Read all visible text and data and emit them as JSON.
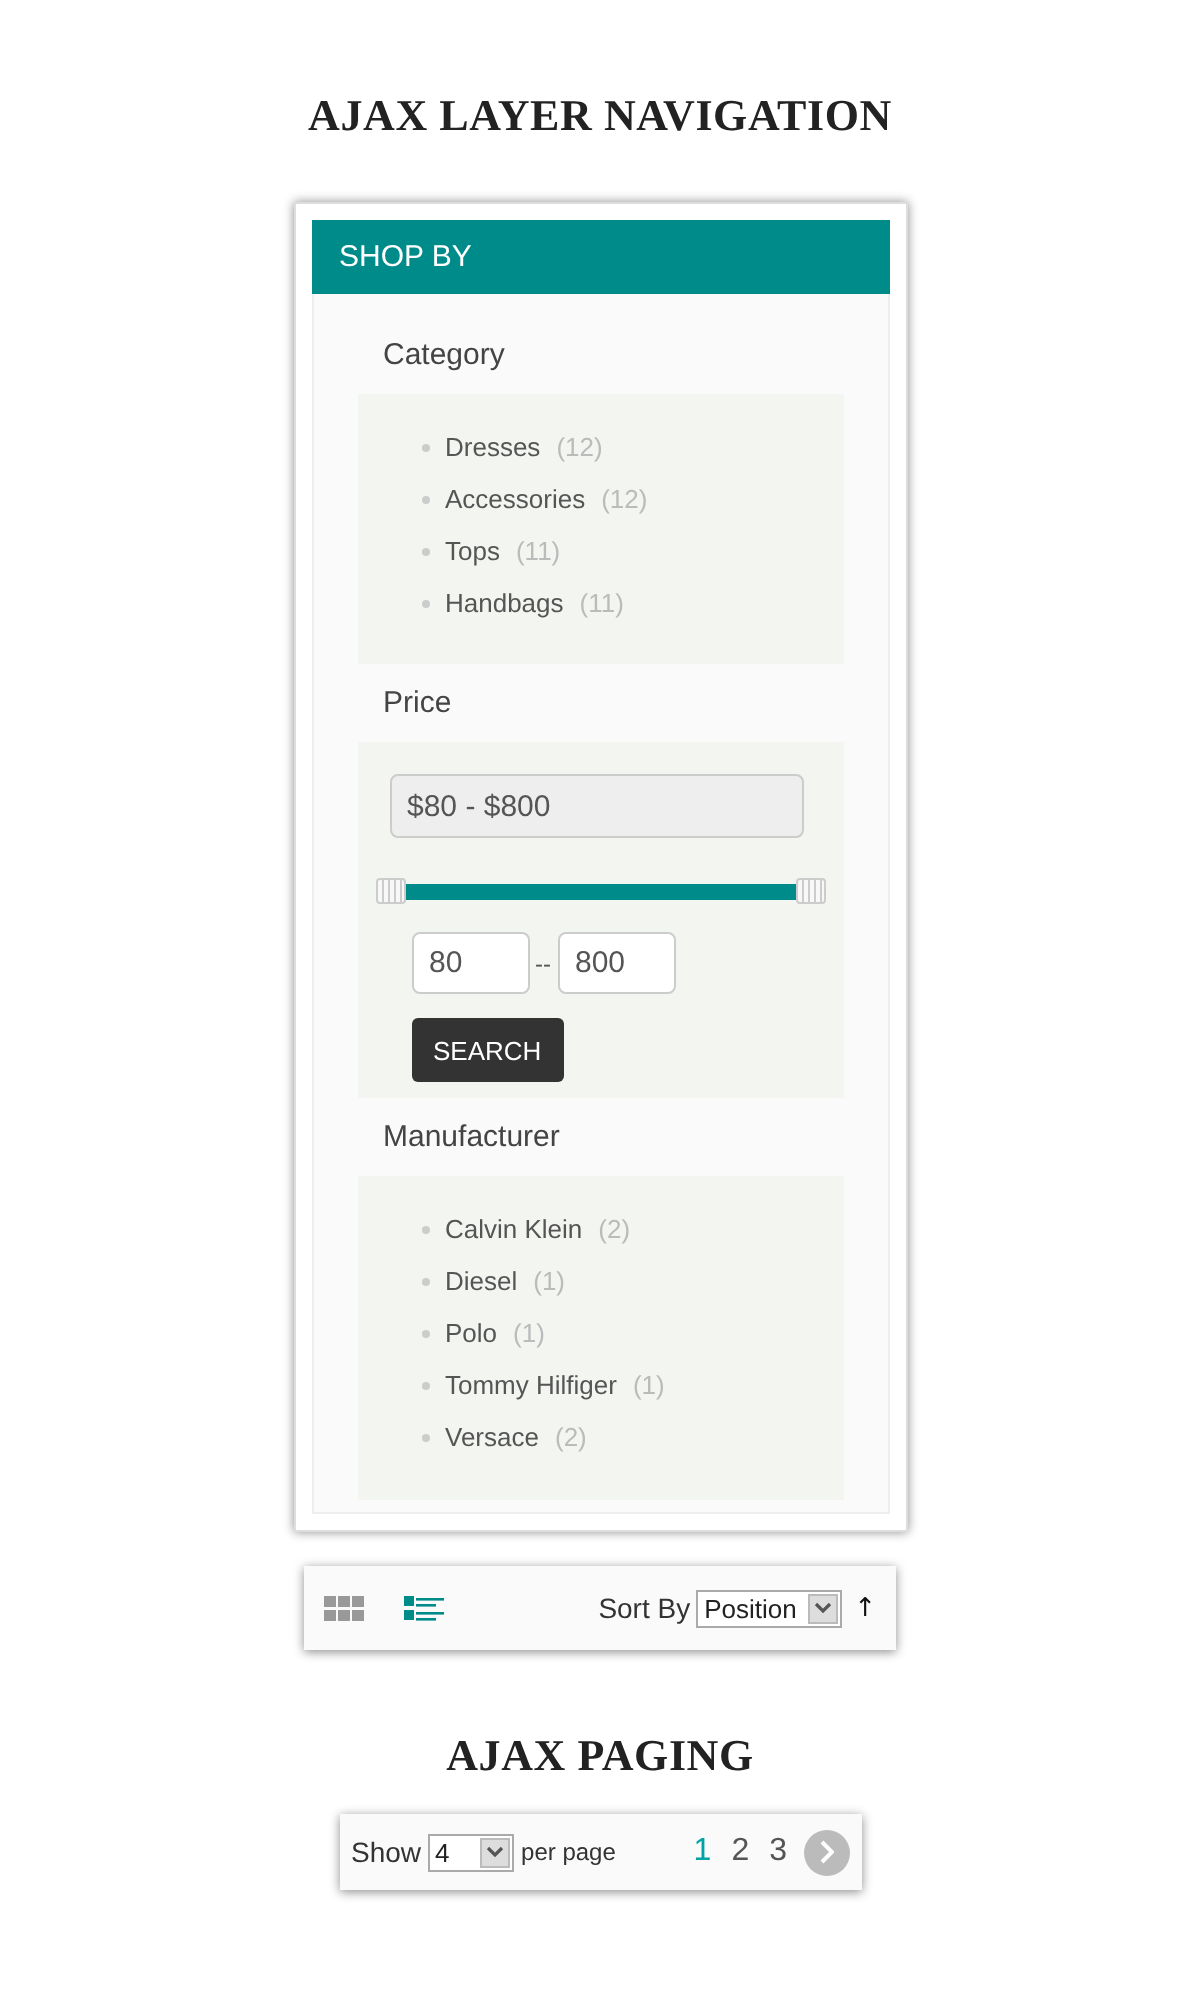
{
  "heading": "AJAX LAYER NAVIGATION",
  "panel": {
    "title": "SHOP BY",
    "category": {
      "title": "Category",
      "items": [
        {
          "label": "Dresses",
          "count": "(12)"
        },
        {
          "label": "Accessories",
          "count": "(12)"
        },
        {
          "label": "Tops",
          "count": "(11)"
        },
        {
          "label": "Handbags",
          "count": "(11)"
        }
      ]
    },
    "price": {
      "title": "Price",
      "range": "$80 - $800",
      "level": 1,
      "min": "80",
      "separator": "--",
      "max": "800",
      "button": "SEARCH"
    },
    "manufacturer": {
      "title": "Manufacturer",
      "items": [
        {
          "label": "Calvin Klein",
          "count": "(2)"
        },
        {
          "label": "Diesel",
          "count": "(1)"
        },
        {
          "label": "Polo",
          "count": "(1)"
        },
        {
          "label": "Tommy Hilfiger",
          "count": "(1)"
        },
        {
          "label": "Versace",
          "count": "(2)"
        }
      ]
    }
  },
  "toolbar": {
    "views": [
      {
        "kind": "grid",
        "selected": false
      },
      {
        "kind": "list",
        "selected": true
      }
    ],
    "sort_label": "Sort By",
    "sort_value": "Position",
    "direction": "↑"
  },
  "paging_heading": "AJAX PAGING",
  "pager": {
    "show_label": "Show",
    "per_page_value": "4",
    "per_page_label": "per page",
    "pages": [
      {
        "label": "1",
        "selected": true
      },
      {
        "label": "2",
        "selected": false
      },
      {
        "label": "3",
        "selected": false
      }
    ]
  }
}
